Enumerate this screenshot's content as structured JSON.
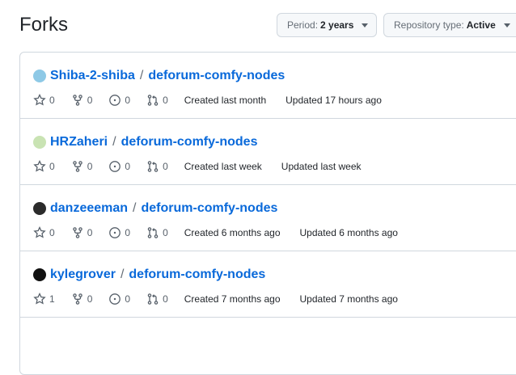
{
  "header": {
    "title": "Forks",
    "period_label": "Period:",
    "period_value": "2 years",
    "repo_type_label": "Repository type:",
    "repo_type_value": "Active"
  },
  "forks": [
    {
      "owner": "Shiba-2-shiba",
      "separator": "/",
      "repo": "deforum-comfy-nodes",
      "stars": "0",
      "forks": "0",
      "issues": "0",
      "pull_requests": "0",
      "created": "Created last month",
      "updated": "Updated 17 hours ago",
      "avatar_color": "#8ec9e6"
    },
    {
      "owner": "HRZaheri",
      "separator": "/",
      "repo": "deforum-comfy-nodes",
      "stars": "0",
      "forks": "0",
      "issues": "0",
      "pull_requests": "0",
      "created": "Created last week",
      "updated": "Updated last week",
      "avatar_color": "#c9e3b3"
    },
    {
      "owner": "danzeeeman",
      "separator": "/",
      "repo": "deforum-comfy-nodes",
      "stars": "0",
      "forks": "0",
      "issues": "0",
      "pull_requests": "0",
      "created": "Created 6 months ago",
      "updated": "Updated 6 months ago",
      "avatar_color": "#2b2b2b"
    },
    {
      "owner": "kylegrover",
      "separator": "/",
      "repo": "deforum-comfy-nodes",
      "stars": "1",
      "forks": "0",
      "issues": "0",
      "pull_requests": "0",
      "created": "Created 7 months ago",
      "updated": "Updated 7 months ago",
      "avatar_color": "#111111"
    }
  ],
  "colors": {
    "link": "#0969da",
    "border": "#d0d7de",
    "muted": "#656d76"
  }
}
